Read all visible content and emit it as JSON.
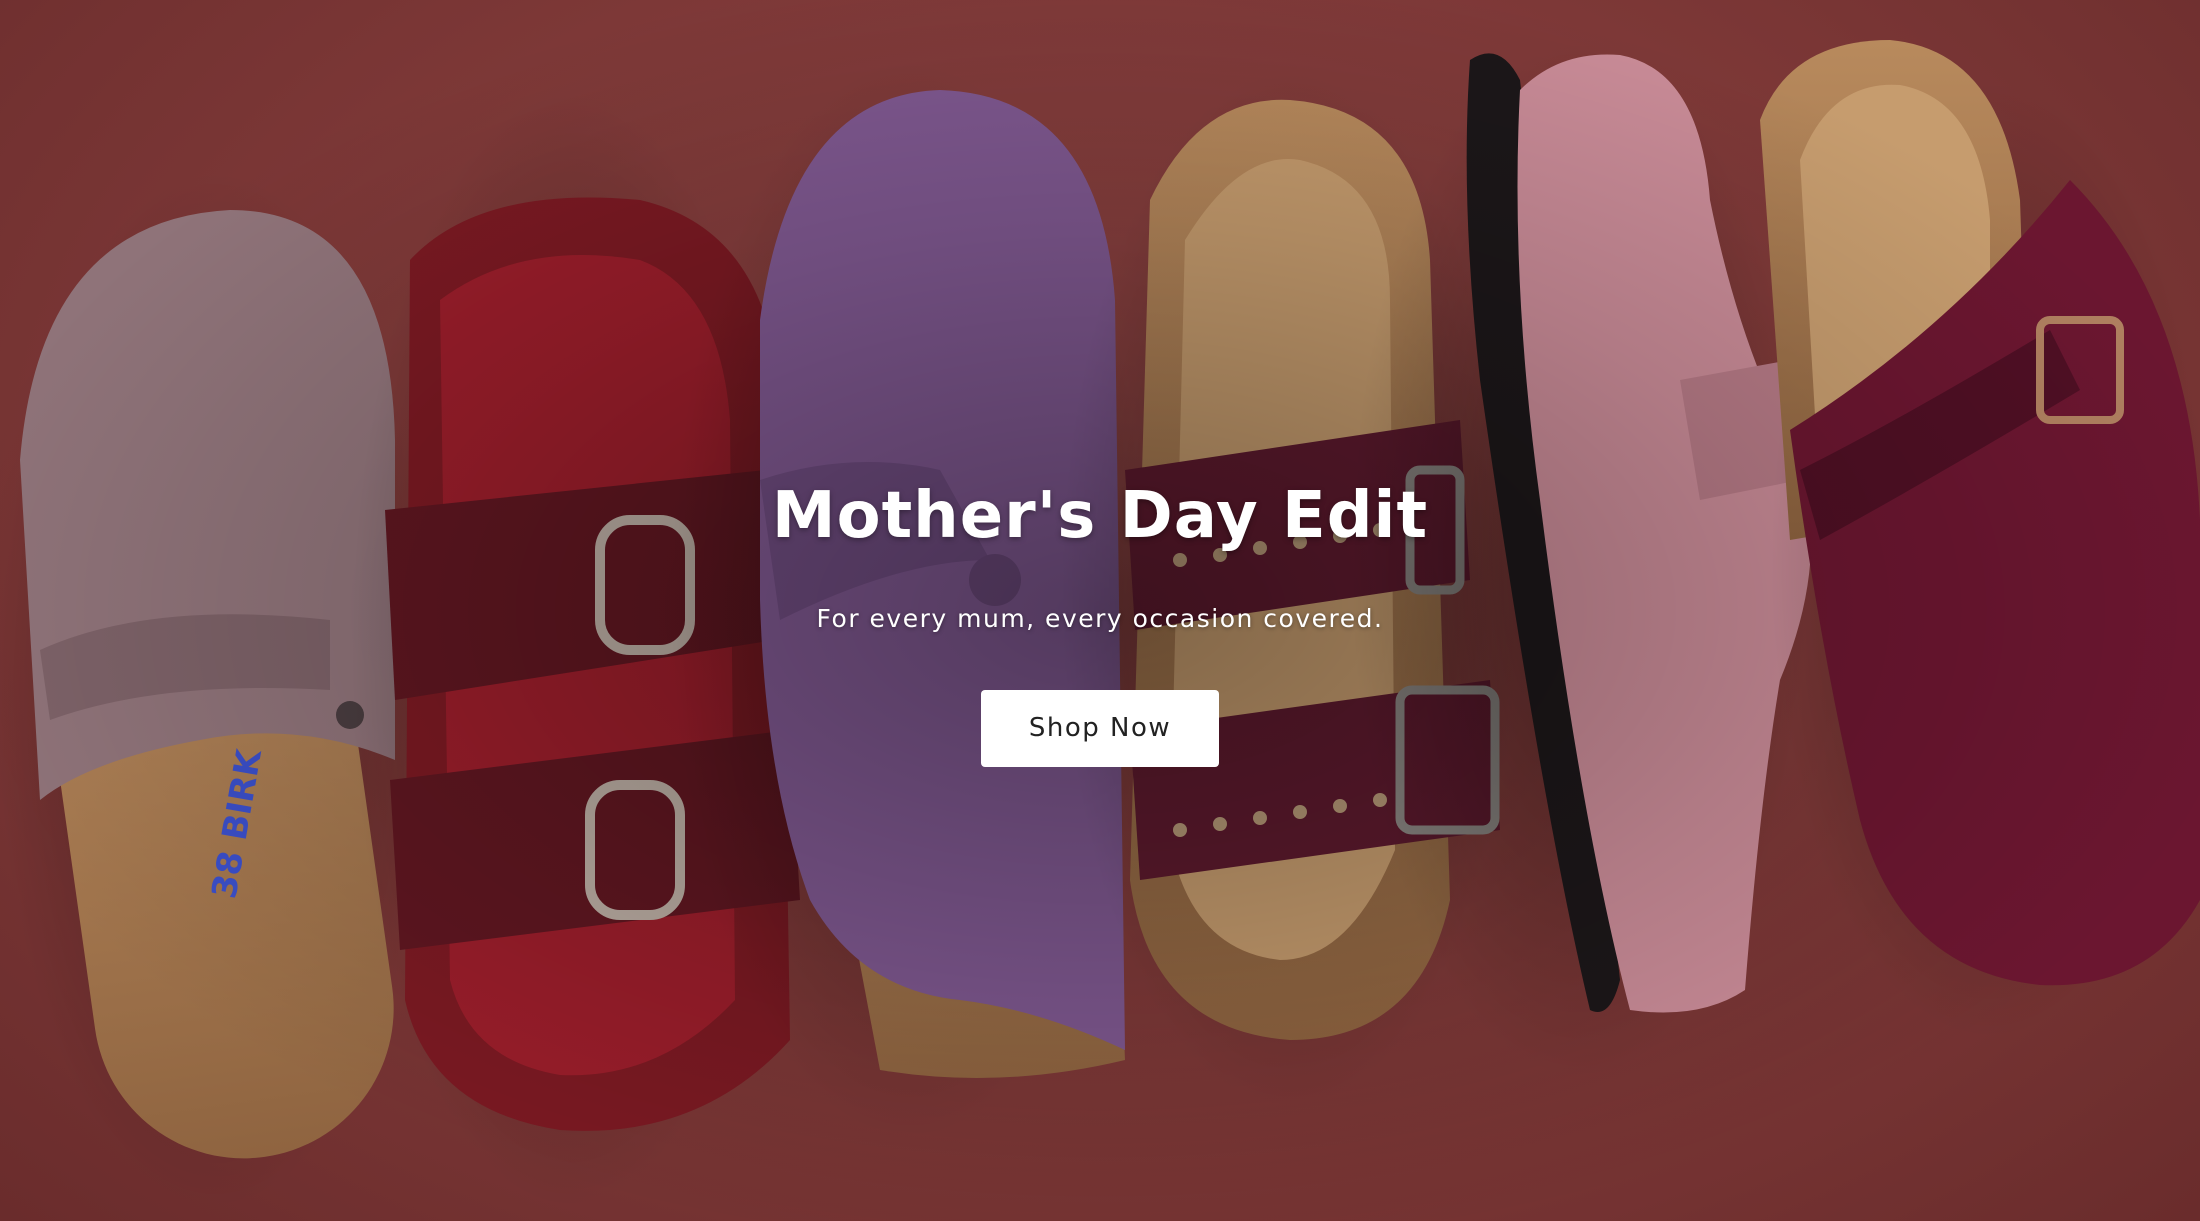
{
  "hero": {
    "title": "Mother's Day Edit",
    "subtitle": "For every mum, every occasion covered.",
    "cta_label": "Shop Now",
    "background_color": "#7d3837",
    "image_subject": "shoes-photo"
  },
  "colors": {
    "button_bg": "#ffffff",
    "button_text": "#222222",
    "text": "#ffffff"
  }
}
